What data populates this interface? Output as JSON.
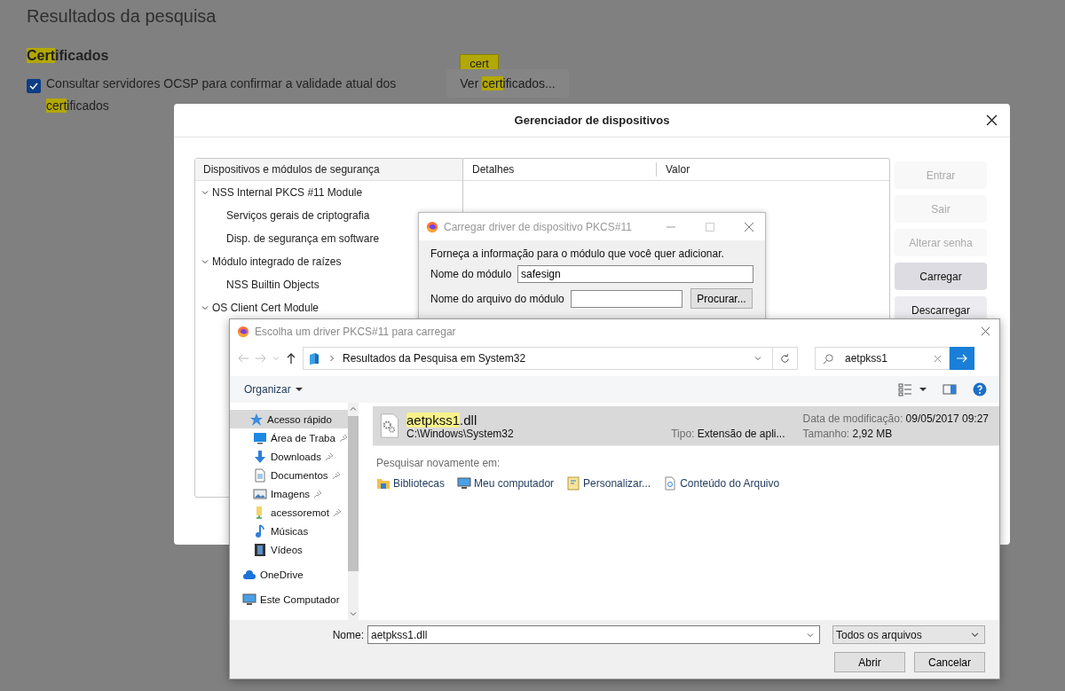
{
  "page": {
    "title": "Resultados da pesquisa",
    "section_title": [
      {
        "text": "Cert",
        "highlighted": true
      },
      {
        "text": "ificados",
        "highlighted": false
      }
    ],
    "ocsp_checkbox": {
      "checked": true,
      "label": [
        {
          "text": "Consultar servidores OCSP para confirmar a validade atual dos ",
          "highlighted": false
        },
        {
          "text": "cert",
          "highlighted": true
        },
        {
          "text": "ificados",
          "highlighted": false
        }
      ]
    },
    "tooltip": "cert",
    "view_button": [
      {
        "text": "Ver ",
        "highlighted": false
      },
      {
        "text": "cert",
        "highlighted": true
      },
      {
        "text": "ificados...",
        "highlighted": false
      }
    ]
  },
  "device_manager": {
    "title": "Gerenciador de dispositivos",
    "tree": {
      "header": "Dispositivos e módulos de segurança",
      "items": [
        {
          "label": "NSS Internal PKCS #11 Module",
          "expanded": true,
          "children": [
            {
              "label": "Serviços gerais de criptografia"
            },
            {
              "label": "Disp. de segurança em software"
            }
          ]
        },
        {
          "label": "Módulo integrado de raízes",
          "expanded": true,
          "children": [
            {
              "label": "NSS Builtin Objects"
            }
          ]
        },
        {
          "label": "OS Client Cert Module",
          "expanded": true
        }
      ]
    },
    "details": {
      "columns": [
        "Detalhes",
        "Valor"
      ]
    },
    "buttons": [
      {
        "label": "Entrar",
        "disabled": true,
        "selected": false
      },
      {
        "label": "Sair",
        "disabled": true,
        "selected": false
      },
      {
        "label": "Alterar senha",
        "disabled": true,
        "selected": false
      },
      {
        "label": "Carregar",
        "disabled": false,
        "selected": true
      },
      {
        "label": "Descarregar",
        "disabled": false,
        "selected": false
      }
    ]
  },
  "load_driver_dialog": {
    "title": "Carregar driver de dispositivo PKCS#11",
    "instruction": "Forneça a informação para o módulo que você quer adicionar.",
    "fields": [
      {
        "label": "Nome do módulo",
        "value": "safesign"
      },
      {
        "label": "Nome do arquivo do módulo"
      }
    ],
    "browse_button": "Procurar..."
  },
  "file_dialog": {
    "title": "Escolha um driver PKCS#11 para carregar",
    "address": "Resultados da Pesquisa em System32",
    "search": {
      "value": "aetpkss1"
    },
    "organize": "Organizar",
    "nav": [
      {
        "label": "Acesso rápido",
        "kind": "star",
        "pinned": false,
        "selected": true
      },
      {
        "label": "Área de Traba",
        "kind": "desktop",
        "pinned": true,
        "selected": false
      },
      {
        "label": "Downloads",
        "kind": "download",
        "pinned": true,
        "selected": false
      },
      {
        "label": "Documentos",
        "kind": "document",
        "pinned": true,
        "selected": false
      },
      {
        "label": "Imagens",
        "kind": "image",
        "pinned": true,
        "selected": false
      },
      {
        "label": "acessoremot",
        "kind": "folder",
        "pinned": true,
        "selected": false
      },
      {
        "label": "Músicas",
        "kind": "music",
        "pinned": false,
        "selected": false
      },
      {
        "label": "Vídeos",
        "kind": "video",
        "pinned": false,
        "selected": false
      },
      {
        "label": "OneDrive",
        "kind": "cloud",
        "pinned": false,
        "selected": false
      },
      {
        "label": "Este Computador",
        "kind": "computer",
        "pinned": false,
        "selected": false
      }
    ],
    "results": [
      {
        "name": [
          {
            "text": "aetpkss1",
            "highlighted": true
          },
          {
            "text": ".dll",
            "highlighted": false
          }
        ],
        "path": "C:\\Windows\\System32",
        "type_label": "Tipo:",
        "type": "Extensão de apli...",
        "date_label": "Data de modificação:",
        "date": "09/05/2017 09:27",
        "size_label": "Tamanho:",
        "size": "2,92 MB",
        "selected": true
      }
    ],
    "search_again": {
      "label": "Pesquisar novamente em:",
      "locations": [
        {
          "label": "Bibliotecas",
          "kind": "library"
        },
        {
          "label": "Meu computador",
          "kind": "computer"
        },
        {
          "label": "Personalizar...",
          "kind": "custom"
        },
        {
          "label": "Conteúdo do Arquivo",
          "kind": "file-content"
        }
      ]
    },
    "filename": {
      "label": "Nome:",
      "value": "aetpkss1.dll"
    },
    "filter": "Todos os arquivos",
    "buttons": [
      "Abrir",
      "Cancelar"
    ]
  }
}
